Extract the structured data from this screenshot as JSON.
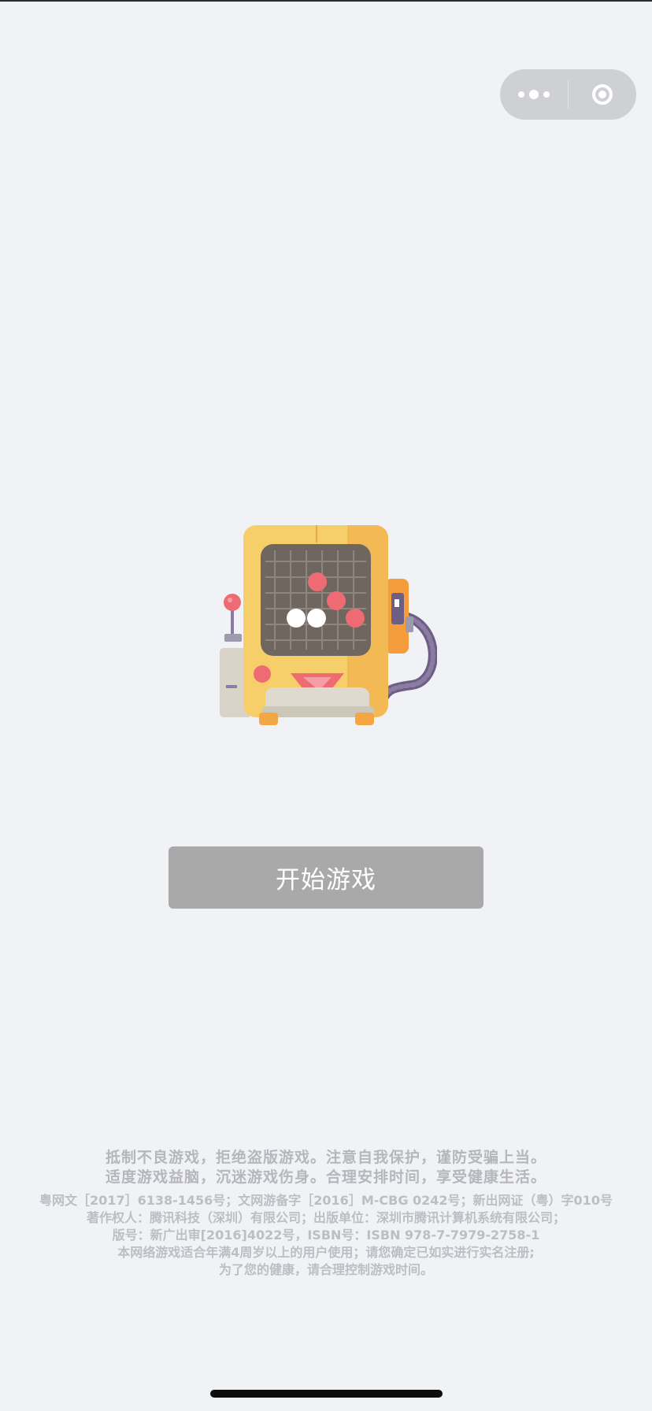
{
  "capsule": {
    "more_icon": "more-dots-icon",
    "close_icon": "target-close-icon"
  },
  "mascot": {
    "icon": "arcade-machine-gomoku-illustration",
    "colors": {
      "body": "#f7cf6a",
      "screen": "#6f6660",
      "red_piece": "#ef6b73",
      "white_piece": "#ffffff",
      "side_panel": "#f59c3c"
    }
  },
  "start_button": {
    "label": "开始游戏"
  },
  "footer": {
    "slogan_lines": [
      "抵制不良游戏，拒绝盗版游戏。注意自我保护，谨防受骗上当。",
      "适度游戏益脑，沉迷游戏伤身。合理安排时间，享受健康生活。"
    ],
    "legal_lines": [
      "粤网文［2017］6138-1456号；文网游备字［2016］M-CBG 0242号；新出网证（粤）字010号",
      "著作权人：腾讯科技（深圳）有限公司；出版单位：深圳市腾讯计算机系统有限公司；",
      "版号：新广出审[2016]4022号，ISBN号：ISBN 978-7-7979-2758-1",
      "本网络游戏适合年满4周岁以上的用户使用；请您确定已如实进行实名注册;",
      "为了您的健康，请合理控制游戏时间。"
    ]
  }
}
